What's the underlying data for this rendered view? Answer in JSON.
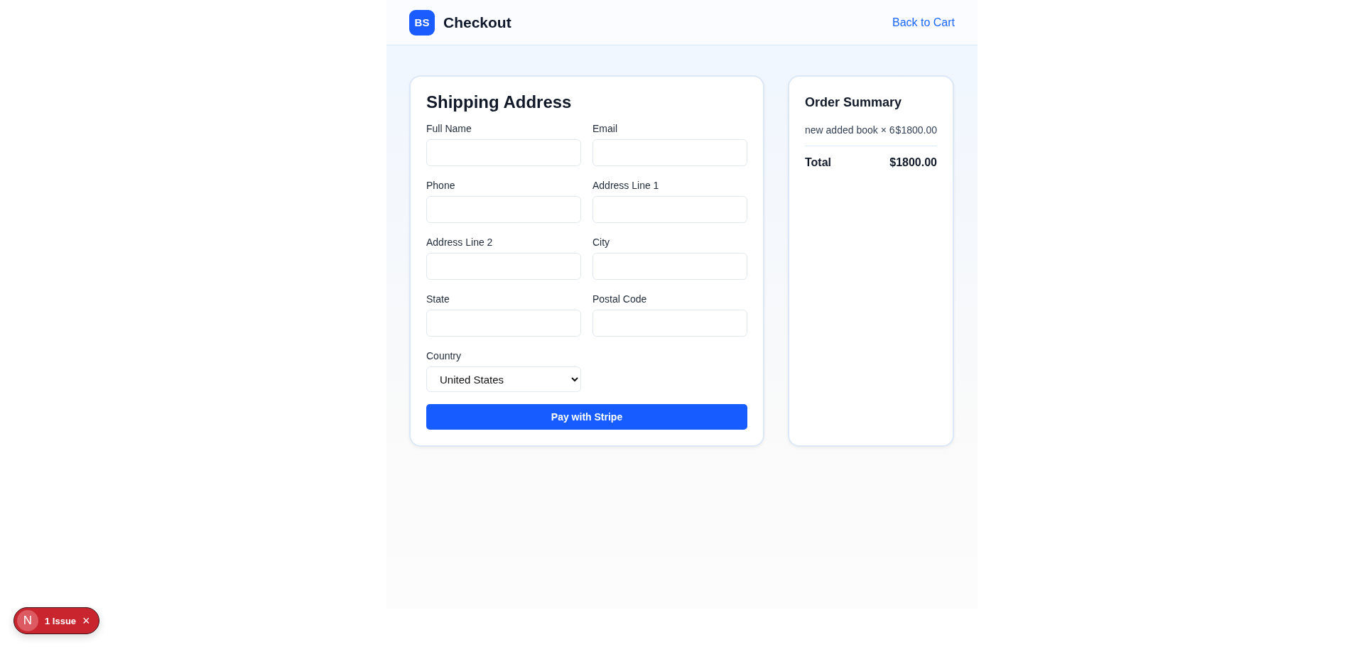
{
  "header": {
    "logo": "BS",
    "title": "Checkout",
    "back_link": "Back to Cart"
  },
  "shipping": {
    "title": "Shipping Address",
    "fields": [
      {
        "label": "Full Name",
        "kind": "text"
      },
      {
        "label": "Email",
        "kind": "text"
      },
      {
        "label": "Phone",
        "kind": "text"
      },
      {
        "label": "Address Line 1",
        "kind": "text"
      },
      {
        "label": "Address Line 2",
        "kind": "text"
      },
      {
        "label": "City",
        "kind": "text"
      },
      {
        "label": "State",
        "kind": "text"
      },
      {
        "label": "Postal Code",
        "kind": "text"
      },
      {
        "label": "Country",
        "kind": "select",
        "value": "United States"
      }
    ],
    "submit": "Pay with Stripe"
  },
  "summary": {
    "title": "Order Summary",
    "items": [
      {
        "name": "new added book × 6",
        "price": "$1800.00"
      }
    ],
    "total_label": "Total",
    "total": "$1800.00"
  },
  "issue_badge": {
    "logo": "N",
    "label": "1 Issue",
    "close": "×"
  }
}
